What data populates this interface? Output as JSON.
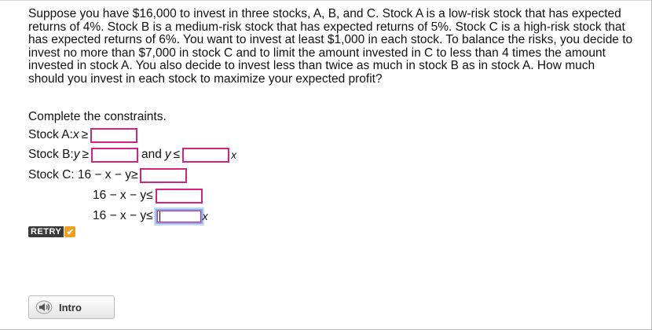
{
  "question": "Suppose you have $16,000 to invest in three stocks, A, B, and C. Stock A is a low-risk stock that has expected returns of 4%. Stock B is a medium-risk stock that has expected returns of 5%. Stock C is a high-risk stock that has expected returns of 6%. You want to invest at least $1,000 in each stock. To balance the risks, you decide to invest no more than $7,000 in stock C and to limit the amount invested in C to less than 4 times the amount invested in stock A. You also decide to invest less than twice as much in stock B as in stock A. How much should you invest in each stock to maximize your expected profit?",
  "instruction": "Complete the constraints.",
  "constraints": {
    "a_prefix": "Stock A: ",
    "a_var": "x",
    "ge": "≥",
    "le": "≤",
    "b_prefix": "Stock B: ",
    "b_var": "y",
    "and": "and",
    "b_var2": "y",
    "x_suffix": "x",
    "c_prefix": "Stock C: 16 − x − y ",
    "c_line2": "16 − x − y ",
    "c_line3": "16 − x − y ",
    "x_suffix2": "x"
  },
  "inputs": {
    "a_value": "",
    "b_value1": "",
    "b_value2": "",
    "c_value1": "",
    "c_value2": "",
    "c_value3": ""
  },
  "retry": {
    "label": "RETRY",
    "check": "✔"
  },
  "intro": {
    "label": "Intro"
  }
}
